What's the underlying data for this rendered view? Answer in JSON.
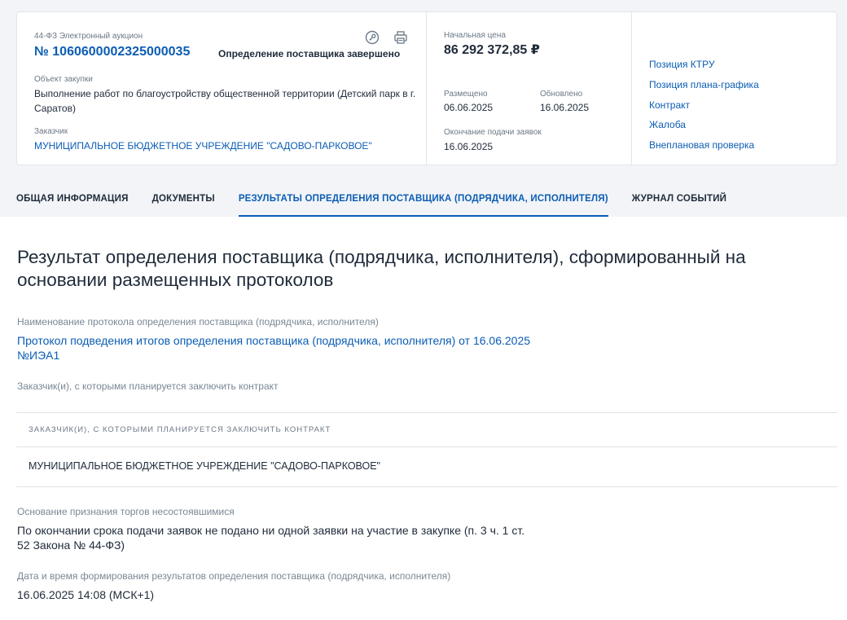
{
  "header": {
    "law_and_type": "44-ФЗ Электронный аукцион",
    "reg_number": "№ 1060600002325000035",
    "status": "Определение поставщика завершено",
    "purchase_object_label": "Объект закупки",
    "purchase_object": "Выполнение работ по благоустройству общественной территории (Детский парк в г. Саратов)",
    "customer_label": "Заказчик",
    "customer": "МУНИЦИПАЛЬНОЕ БЮДЖЕТНОЕ УЧРЕЖДЕНИЕ \"САДОВО-ПАРКОВОЕ\"",
    "icons": [
      "key-icon",
      "print-icon"
    ]
  },
  "pricing": {
    "initial_price_label": "Начальная цена",
    "initial_price": "86 292 372,85 ₽",
    "placed_label": "Размещено",
    "placed_date": "06.06.2025",
    "updated_label": "Обновлено",
    "updated_date": "16.06.2025",
    "deadline_label": "Окончание подачи заявок",
    "deadline_date": "16.06.2025"
  },
  "related_links": [
    "Позиция КТРУ",
    "Позиция плана-графика",
    "Контракт",
    "Жалоба",
    "Внеплановая проверка"
  ],
  "tabs": [
    {
      "label": "ОБЩАЯ ИНФОРМАЦИЯ",
      "active": false
    },
    {
      "label": "ДОКУМЕНТЫ",
      "active": false
    },
    {
      "label": "РЕЗУЛЬТАТЫ ОПРЕДЕЛЕНИЯ ПОСТАВЩИКА (ПОДРЯДЧИКА, ИСПОЛНИТЕЛЯ)",
      "active": true
    },
    {
      "label": "ЖУРНАЛ СОБЫТИЙ",
      "active": false
    }
  ],
  "main": {
    "title": "Результат определения поставщика (подрядчика, исполнителя), сформированный на основании размещенных протоколов",
    "protocol_label": "Наименование протокола определения поставщика (подрядчика, исполнителя)",
    "protocol_value_line1": "Протокол подведения итогов определения поставщика (подрядчика, исполнителя) от 16.06.2025",
    "protocol_value_line2": "№ИЭА1",
    "customers_label": "Заказчик(и), с которыми планируется заключить контракт",
    "table_header": "Заказчик(и), с которыми планируется заключить контракт",
    "table_rows": [
      "МУНИЦИПАЛЬНОЕ БЮДЖЕТНОЕ УЧРЕЖДЕНИЕ \"САДОВО-ПАРКОВОЕ\""
    ],
    "failure_label": "Основание признания торгов несостоявшимися",
    "failure_value_line1": "По окончании срока подачи заявок не подано ни одной заявки на участие в закупке (п. 3 ч. 1 ст.",
    "failure_value_line2": "52 Закона № 44-ФЗ)",
    "datetime_label": "Дата и время формирования результатов определения поставщика (подрядчика, исполнителя)",
    "datetime_value": "16.06.2025 14:08 (МСК+1)"
  },
  "colors": {
    "accent": "#0b5db4",
    "text": "#1f2b3a",
    "muted": "#7a8794",
    "top_background": "#f2f4f7",
    "border": "#e1e5ea"
  }
}
